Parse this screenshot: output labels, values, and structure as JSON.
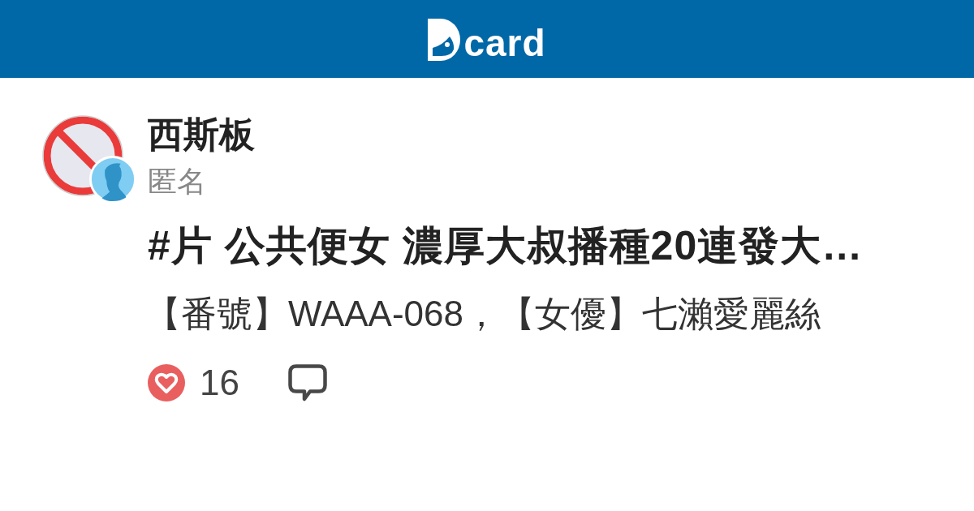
{
  "header": {
    "logo_text": "card"
  },
  "post": {
    "board": "西斯板",
    "author": "匿名",
    "title": "#片 公共便女 濃厚大叔播種20連發大…",
    "excerpt": "【番號】WAAA-068，【女優】七瀨愛麗絲",
    "likes": "16"
  }
}
